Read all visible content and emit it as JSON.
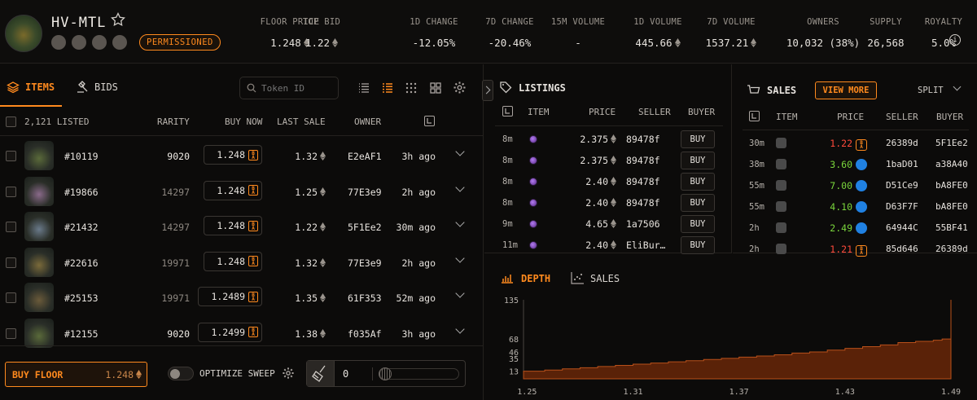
{
  "collection": {
    "name": "HV-MTL",
    "badge": "PERMISSIONED"
  },
  "stats": [
    {
      "label": "FLOOR PRICE",
      "value": "1.248",
      "eth": true,
      "cls": ""
    },
    {
      "label": "TOP BID",
      "value": "1.22",
      "eth": true,
      "cls": ""
    },
    {
      "label": "1D CHANGE",
      "value": "-12.05%",
      "eth": false,
      "cls": "red"
    },
    {
      "label": "7D CHANGE",
      "value": "-20.46%",
      "eth": false,
      "cls": "red"
    },
    {
      "label": "15M VOLUME",
      "value": "-",
      "eth": false,
      "cls": ""
    },
    {
      "label": "1D VOLUME",
      "value": "445.66",
      "eth": true,
      "cls": ""
    },
    {
      "label": "7D VOLUME",
      "value": "1537.21",
      "eth": true,
      "cls": ""
    },
    {
      "label": "OWNERS",
      "value": "10,032 (38%)",
      "eth": false,
      "cls": ""
    },
    {
      "label": "SUPPLY",
      "value": "26,568",
      "eth": false,
      "cls": ""
    },
    {
      "label": "ROYALTY",
      "value": "5.0%",
      "eth": false,
      "cls": ""
    }
  ],
  "left_tabs": {
    "items": "ITEMS",
    "bids": "BIDS"
  },
  "search": {
    "placeholder": "Token ID"
  },
  "items_table": {
    "headers": {
      "listed": "2,121 LISTED",
      "rarity": "RARITY",
      "buy_now": "BUY NOW",
      "last_sale": "LAST SALE",
      "owner": "OWNER"
    },
    "rows": [
      {
        "id": "#10119",
        "rarity": "9020",
        "rarity_bright": true,
        "price": "1.248",
        "last": "1.32",
        "owner": "E2eAF1",
        "time": "3h ago",
        "tone": "#5a6a3a"
      },
      {
        "id": "#19866",
        "rarity": "14297",
        "rarity_bright": false,
        "price": "1.248",
        "last": "1.25",
        "owner": "77E3e9",
        "time": "2h ago",
        "tone": "#8a6a8a"
      },
      {
        "id": "#21432",
        "rarity": "14297",
        "rarity_bright": false,
        "price": "1.248",
        "last": "1.22",
        "owner": "5F1Ee2",
        "time": "30m ago",
        "tone": "#6a7a8a"
      },
      {
        "id": "#22616",
        "rarity": "19971",
        "rarity_bright": false,
        "price": "1.248",
        "last": "1.32",
        "owner": "77E3e9",
        "time": "2h ago",
        "tone": "#7a6a3a"
      },
      {
        "id": "#25153",
        "rarity": "19971",
        "rarity_bright": false,
        "price": "1.2489",
        "last": "1.35",
        "owner": "61F353",
        "time": "52m ago",
        "tone": "#6a5a3a"
      },
      {
        "id": "#12155",
        "rarity": "9020",
        "rarity_bright": true,
        "price": "1.2499",
        "last": "1.38",
        "owner": "f035Af",
        "time": "3h ago",
        "tone": "#5a6a3a"
      }
    ]
  },
  "footer": {
    "buy_floor": "BUY FLOOR",
    "buy_floor_price": "1.248",
    "optimize": "OPTIMIZE SWEEP",
    "sweep_count": "0"
  },
  "listings": {
    "title": "LISTINGS",
    "headers": {
      "item": "ITEM",
      "price": "PRICE",
      "seller": "SELLER",
      "buyer": "BUYER"
    },
    "rows": [
      {
        "time": "8m",
        "price": "2.375",
        "seller": "89478f",
        "btn": "BUY"
      },
      {
        "time": "8m",
        "price": "2.375",
        "seller": "89478f",
        "btn": "BUY"
      },
      {
        "time": "8m",
        "price": "2.40",
        "seller": "89478f",
        "btn": "BUY"
      },
      {
        "time": "8m",
        "price": "2.40",
        "seller": "89478f",
        "btn": "BUY"
      },
      {
        "time": "9m",
        "price": "4.65",
        "seller": "1a7506",
        "btn": "BUY"
      },
      {
        "time": "11m",
        "price": "2.40",
        "seller": "EliBur…",
        "btn": "BUY"
      }
    ]
  },
  "sales": {
    "title": "SALES",
    "view_more": "VIEW MORE",
    "split": "SPLIT",
    "headers": {
      "item": "ITEM",
      "price": "PRICE",
      "seller": "SELLER",
      "buyer": "BUYER"
    },
    "rows": [
      {
        "time": "30m",
        "price": "1.22",
        "cls": "red",
        "market": "weth",
        "seller": "26389d",
        "buyer": "5F1Ee2"
      },
      {
        "time": "38m",
        "price": "3.60",
        "cls": "green",
        "market": "os",
        "seller": "1baD01",
        "buyer": "a38A40"
      },
      {
        "time": "55m",
        "price": "7.00",
        "cls": "green",
        "market": "os",
        "seller": "D51Ce9",
        "buyer": "bA8FE0"
      },
      {
        "time": "55m",
        "price": "4.10",
        "cls": "green",
        "market": "os",
        "seller": "D63F7F",
        "buyer": "bA8FE0"
      },
      {
        "time": "2h",
        "price": "2.49",
        "cls": "green",
        "market": "os",
        "seller": "64944C",
        "buyer": "55BF41"
      },
      {
        "time": "2h",
        "price": "1.21",
        "cls": "red",
        "market": "weth",
        "seller": "85d646",
        "buyer": "26389d"
      }
    ]
  },
  "depth_tabs": {
    "depth": "DEPTH",
    "sales": "SALES"
  },
  "chart_data": {
    "type": "area",
    "title": "",
    "xlabel": "",
    "ylabel": "",
    "xlim": [
      1.248,
      1.49
    ],
    "ylim": [
      0,
      135
    ],
    "x_ticks": [
      "1.25",
      "1.31",
      "1.37",
      "1.43",
      "1.49"
    ],
    "y_ticks": [
      "135",
      "68",
      "46",
      "35",
      "13"
    ],
    "series": [
      {
        "x": [
          1.248,
          1.26,
          1.27,
          1.28,
          1.29,
          1.3,
          1.31,
          1.32,
          1.33,
          1.34,
          1.35,
          1.36,
          1.37,
          1.38,
          1.39,
          1.4,
          1.41,
          1.42,
          1.43,
          1.44,
          1.45,
          1.46,
          1.47,
          1.48,
          1.485,
          1.49
        ],
        "y": [
          13,
          15,
          17,
          19,
          21,
          23,
          25,
          27,
          29,
          31,
          33,
          35,
          37,
          39,
          41,
          44,
          46,
          49,
          52,
          55,
          58,
          62,
          64,
          66,
          68,
          135
        ]
      }
    ]
  }
}
